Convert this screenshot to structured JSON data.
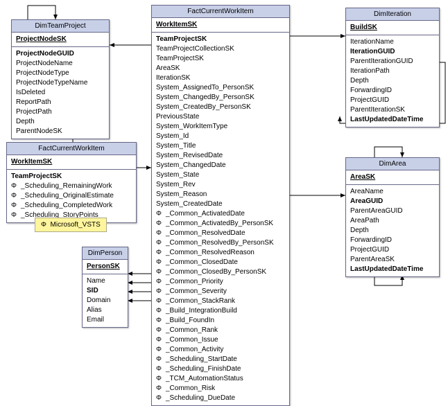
{
  "legend": {
    "phi": "Φ",
    "text": "Microsoft_VSTS"
  },
  "tables": {
    "dimTeamProject": {
      "title": "DimTeamProject",
      "pk": "ProjectNodeSK",
      "fields": [
        {
          "name": "ProjectNodeGUID",
          "bold": true
        },
        {
          "name": "ProjectNodeName"
        },
        {
          "name": "ProjectNodeType"
        },
        {
          "name": "ProjectNodeTypeName"
        },
        {
          "name": "IsDeleted"
        },
        {
          "name": "ReportPath"
        },
        {
          "name": "ProjectPath"
        },
        {
          "name": "Depth"
        },
        {
          "name": "ParentNodeSK"
        }
      ]
    },
    "factCurrentWorkItemSmall": {
      "title": "FactCurrentWorkItem",
      "pk": "WorkItemSK",
      "fields": [
        {
          "name": "TeamProjectSK",
          "bold": true
        },
        {
          "name": "_Scheduling_RemainingWork",
          "phi": true
        },
        {
          "name": "_Scheduling_OriginalEstimate",
          "phi": true
        },
        {
          "name": "_Scheduling_CompletedWork",
          "phi": true
        },
        {
          "name": "_Scheduling_StoryPoints",
          "phi": true
        }
      ]
    },
    "dimPerson": {
      "title": "DimPerson",
      "pk": "PersonSK",
      "fields": [
        {
          "name": "Name"
        },
        {
          "name": "SID",
          "bold": true
        },
        {
          "name": "Domain"
        },
        {
          "name": "Alias"
        },
        {
          "name": "Email"
        }
      ]
    },
    "factCurrentWorkItemBig": {
      "title": "FactCurrentWorkItem",
      "pk": "WorkItemSK",
      "fields": [
        {
          "name": "TeamProjectSK",
          "bold": true
        },
        {
          "name": "TeamProjectCollectionSK"
        },
        {
          "name": "TeamProjectSK"
        },
        {
          "name": "AreaSK"
        },
        {
          "name": "IterationSK"
        },
        {
          "name": "System_AssignedTo_PersonSK"
        },
        {
          "name": "System_ChangedBy_PersonSK"
        },
        {
          "name": "System_CreatedBy_PersonSK"
        },
        {
          "name": "PreviousState"
        },
        {
          "name": "System_WorkItemType"
        },
        {
          "name": "System_Id"
        },
        {
          "name": "System_Title"
        },
        {
          "name": "System_RevisedDate"
        },
        {
          "name": "System_ChangedDate"
        },
        {
          "name": "System_State"
        },
        {
          "name": "System_Rev"
        },
        {
          "name": "System_Reason"
        },
        {
          "name": "System_CreatedDate"
        },
        {
          "name": "_Common_ActivatedDate",
          "phi": true
        },
        {
          "name": "_Common_ActivatedBy_PersonSK",
          "phi": true
        },
        {
          "name": "_Common_ResolvedDate",
          "phi": true
        },
        {
          "name": "_Common_ResolvedBy_PersonSK",
          "phi": true
        },
        {
          "name": "_Common_ResolvedReason",
          "phi": true
        },
        {
          "name": "_Common_ClosedDate",
          "phi": true
        },
        {
          "name": "_Common_ClosedBy_PersonSK",
          "phi": true
        },
        {
          "name": "_Common_Priority",
          "phi": true
        },
        {
          "name": "_Common_Severity",
          "phi": true
        },
        {
          "name": "_Common_StackRank",
          "phi": true
        },
        {
          "name": "_Build_IntegrationBuild",
          "phi": true
        },
        {
          "name": "_Build_FoundIn",
          "phi": true
        },
        {
          "name": "_Common_Rank",
          "phi": true
        },
        {
          "name": "_Common_Issue",
          "phi": true
        },
        {
          "name": "_Common_Activity",
          "phi": true
        },
        {
          "name": "_Scheduling_StartDate",
          "phi": true
        },
        {
          "name": "_Scheduling_FinishDate",
          "phi": true
        },
        {
          "name": "_TCM_AutomationStatus",
          "phi": true
        },
        {
          "name": "_Common_Risk",
          "phi": true
        },
        {
          "name": "_Scheduling_DueDate",
          "phi": true
        }
      ]
    },
    "dimIteration": {
      "title": "DimIteration",
      "pk": "BuildSK",
      "fields": [
        {
          "name": "IterationName"
        },
        {
          "name": "IterationGUID",
          "bold": true
        },
        {
          "name": "ParentIterationGUID"
        },
        {
          "name": "IterationPath"
        },
        {
          "name": "Depth"
        },
        {
          "name": "ForwardingID"
        },
        {
          "name": "ProjectGUID"
        },
        {
          "name": "ParentIterationSK"
        },
        {
          "name": "LastUpdatedDateTime",
          "bold": true
        }
      ]
    },
    "dimArea": {
      "title": "DimArea",
      "pk": "AreaSK",
      "fields": [
        {
          "name": "AreaName"
        },
        {
          "name": "AreaGUID",
          "bold": true
        },
        {
          "name": "ParentAreaGUID"
        },
        {
          "name": "AreaPath"
        },
        {
          "name": "Depth"
        },
        {
          "name": "ForwardingID"
        },
        {
          "name": "ProjectGUID"
        },
        {
          "name": "ParentAreaSK"
        },
        {
          "name": "LastUpdatedDateTime",
          "bold": true
        }
      ]
    }
  }
}
